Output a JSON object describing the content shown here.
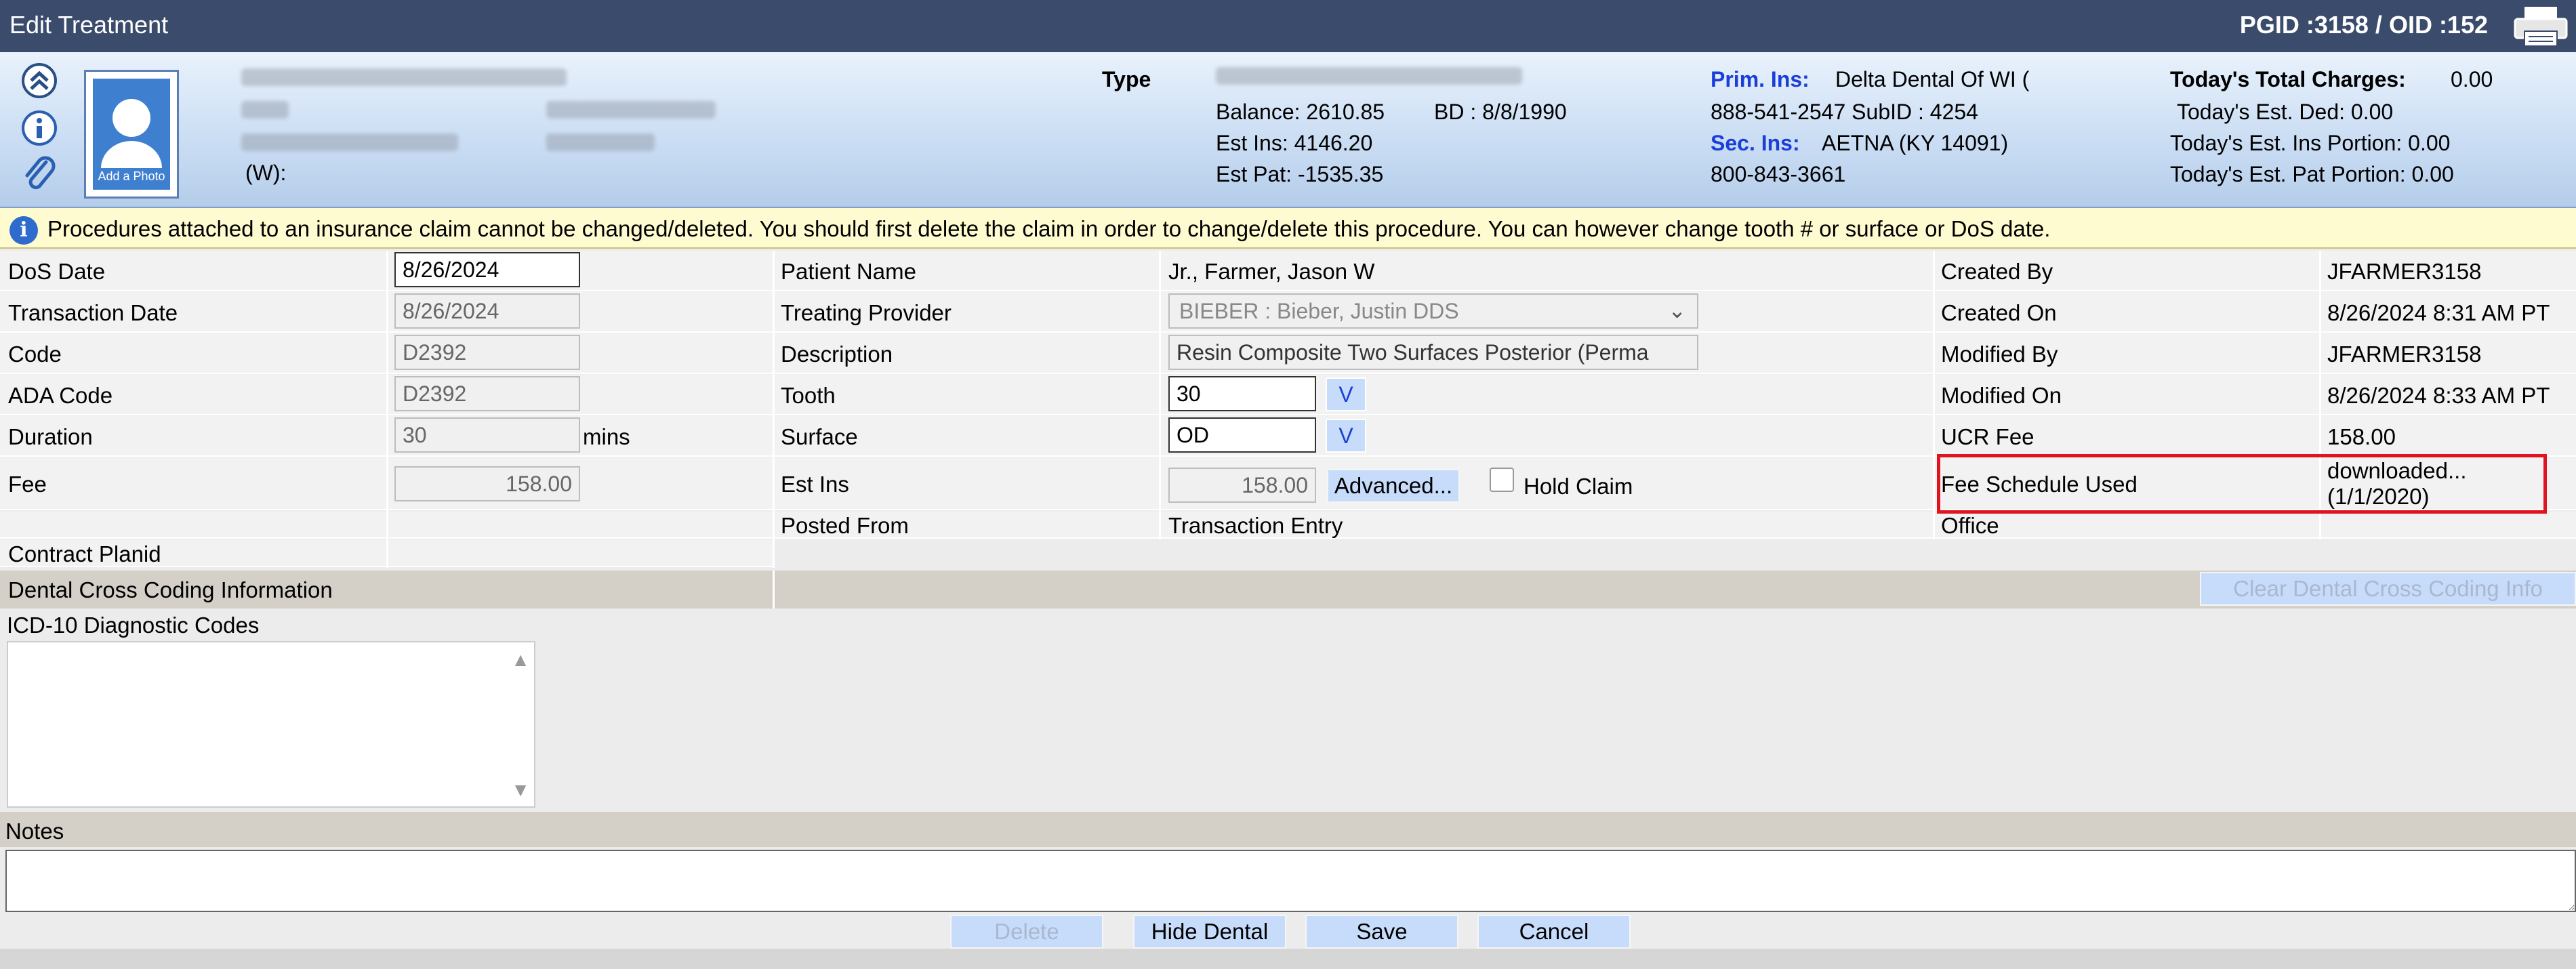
{
  "window": {
    "title": "Edit Treatment",
    "ids": "PGID :3158  /  OID :152"
  },
  "header": {
    "photo_caption": "Add a Photo",
    "work_phone_label": "(W):",
    "type_label": "Type",
    "balance": "Balance: 2610.85",
    "bd": "BD : 8/8/1990",
    "est_ins": "Est Ins:  4146.20",
    "est_pat": "Est Pat: -1535.35",
    "prim_ins_label": "Prim. Ins:",
    "prim_ins_value": "Delta Dental Of WI (",
    "prim_ins_line2": "888-541-2547 SubID : 4254",
    "sec_ins_label": "Sec. Ins:",
    "sec_ins_value": "AETNA (KY 14091)",
    "sec_ins_line2": "800-843-3661",
    "total_charges_label": "Today's Total Charges:",
    "total_charges_value": "0.00",
    "est_ded": "Today's Est. Ded:    0.00",
    "est_ins_portion": "Today's Est. Ins Portion: 0.00",
    "est_pat_portion": "Today's Est. Pat Portion: 0.00"
  },
  "banner": {
    "text": "Procedures attached to an insurance claim cannot be changed/deleted. You should first delete the claim in order to change/delete this procedure. You can however change tooth # or surface or DoS date."
  },
  "form": {
    "dos_label": "DoS Date",
    "dos_value": "8/26/2024",
    "txn_label": "Transaction Date",
    "txn_value": "8/26/2024",
    "code_label": "Code",
    "code_value": "D2392",
    "ada_label": "ADA Code",
    "ada_value": "D2392",
    "duration_label": "Duration",
    "duration_value": "30",
    "duration_unit": "mins",
    "fee_label": "Fee",
    "fee_value": "158.00",
    "contract_label": "Contract Planid",
    "patient_label": "Patient Name",
    "patient_value": "Jr., Farmer, Jason W",
    "provider_label": "Treating Provider",
    "provider_value": "BIEBER : Bieber, Justin DDS",
    "desc_label": "Description",
    "desc_value": "Resin Composite Two Surfaces Posterior (Perma",
    "tooth_label": "Tooth",
    "tooth_value": "30",
    "surface_label": "Surface",
    "surface_value": "OD",
    "v_label": "V",
    "estins_label": "Est Ins",
    "estins_value": "158.00",
    "advanced_label": "Advanced...",
    "hold_claim_label": "Hold Claim",
    "posted_label": "Posted From",
    "posted_value": "Transaction Entry",
    "created_by_label": "Created By",
    "created_by_value": "JFARMER3158",
    "created_on_label": "Created On",
    "created_on_value": "8/26/2024 8:31 AM PT",
    "modified_by_label": "Modified By",
    "modified_by_value": "JFARMER3158",
    "modified_on_label": "Modified On",
    "modified_on_value": "8/26/2024 8:33 AM PT",
    "ucr_label": "UCR Fee",
    "ucr_value": "158.00",
    "fee_sched_label": "Fee Schedule Used",
    "fee_sched_line1": "downloaded...",
    "fee_sched_line2": "(1/1/2020)",
    "office_label": "Office"
  },
  "sections": {
    "cross_coding": "Dental Cross Coding Information",
    "clear_cross": "Clear Dental Cross Coding Info",
    "icd": "ICD-10 Diagnostic Codes",
    "notes": "Notes"
  },
  "actions": {
    "delete": "Delete",
    "hide_dental": "Hide Dental",
    "save": "Save",
    "cancel": "Cancel"
  }
}
